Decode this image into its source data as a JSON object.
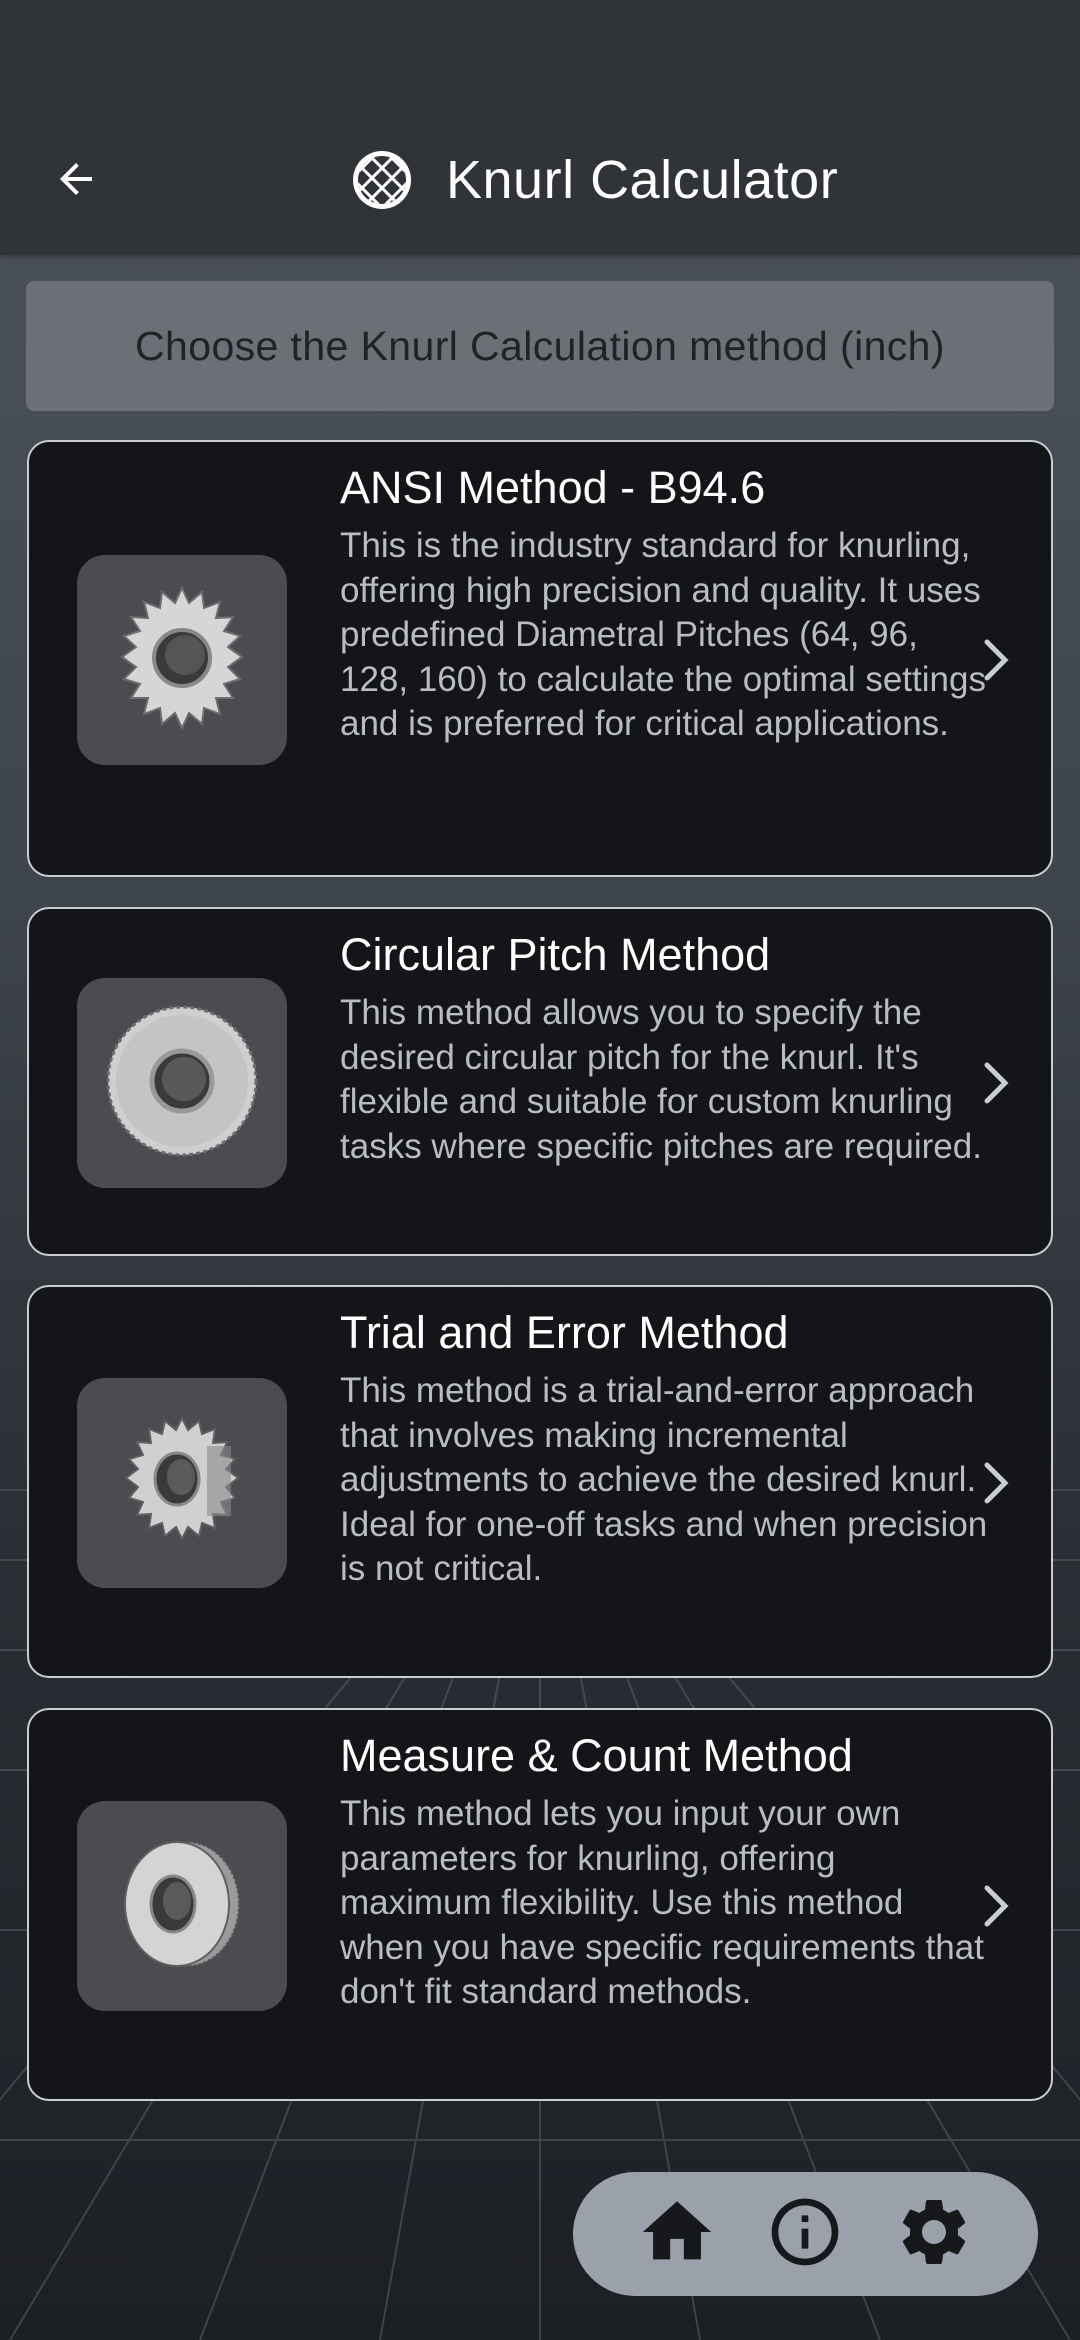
{
  "app_bar": {
    "title": "Knurl Calculator",
    "back_icon": "arrow-back-icon",
    "logo_icon": "knurl-pattern-icon"
  },
  "banner": {
    "text": "Choose the Knurl Calculation method (inch)"
  },
  "methods": [
    {
      "title": "ANSI Method - B94.6",
      "description": "This is the industry standard for knurling, offering high precision and quality. It uses predefined Diametral Pitches (64, 96, 128, 160) to calculate the optimal settings and is preferred for critical applications.",
      "icon": "knurl-wheel-icon"
    },
    {
      "title": "Circular Pitch Method",
      "description": "This method allows you to specify the desired circular pitch for the knurl. It's flexible and suitable for custom knurling tasks where specific pitches are required.",
      "icon": "knurl-wheel-icon"
    },
    {
      "title": "Trial and Error Method",
      "description": "This method is a trial-and-error approach that involves making incremental adjustments to achieve the desired knurl. Ideal for one-off tasks and when precision is not critical.",
      "icon": "knurl-wheel-icon"
    },
    {
      "title": "Measure & Count Method",
      "description": "This method lets you input your own parameters for knurling, offering maximum flexibility. Use this method when you have specific requirements that don't fit standard methods.",
      "icon": "knurl-wheel-icon"
    }
  ],
  "bottom_nav": {
    "items": [
      "home-icon",
      "info-icon",
      "settings-gear-icon"
    ]
  },
  "colors": {
    "card_bg": "#141518",
    "card_border": "#c9ccd1",
    "banner_bg": "#6b6f76",
    "nav_bg": "#9aa1aa",
    "app_bar_bg": "#303338"
  }
}
